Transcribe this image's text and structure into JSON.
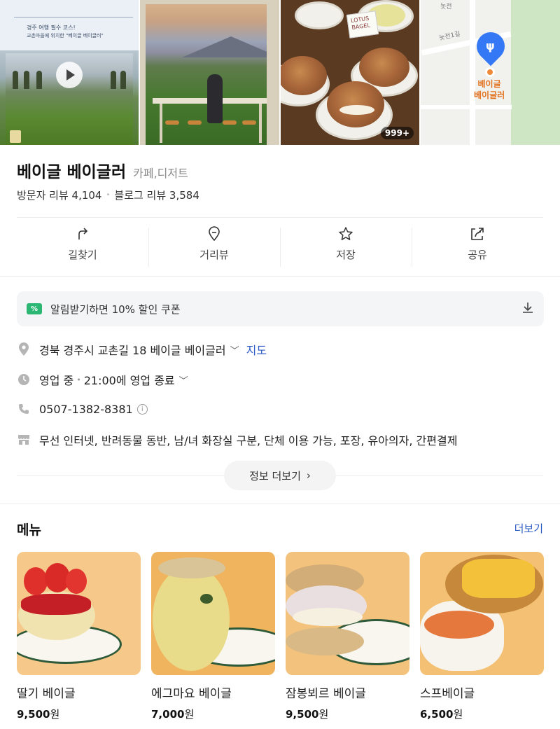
{
  "photos": {
    "poster_line1": "경주 여행 필수 코스!",
    "poster_line2": "교촌마을에 위치한 \"베이글 베이글러\"",
    "bakery_sign": "LOTUS BAGEL",
    "photo_count_badge": "999+",
    "map_road_label": "놋전1길",
    "map_road_label2": "놋전",
    "map_place_label_line1": "베이글",
    "map_place_label_line2": "베이글러"
  },
  "place": {
    "name": "베이글 베이글러",
    "category": "카페,디저트",
    "visitor_review_label": "방문자 리뷰 4,104",
    "blog_review_label": "블로그 리뷰 3,584"
  },
  "actions": [
    {
      "label": "길찾기",
      "icon": "directions-icon"
    },
    {
      "label": "거리뷰",
      "icon": "street-view-icon"
    },
    {
      "label": "저장",
      "icon": "star-icon"
    },
    {
      "label": "공유",
      "icon": "share-icon"
    }
  ],
  "coupon": {
    "icon_text": "%",
    "text": "알림받기하면 10% 할인 쿠폰"
  },
  "info": {
    "address": "경북 경주시 교촌길 18 베이글 베이글러",
    "map_link": "지도",
    "status": "영업 중",
    "hours": "21:00에 영업 종료",
    "phone": "0507-1382-8381",
    "phone_info_icon": "i",
    "amenities": "무선 인터넷, 반려동물 동반, 남/녀 화장실 구분, 단체 이용 가능, 포장, 유아의자, 간편결제",
    "more_info_label": "정보 더보기"
  },
  "menu": {
    "title": "메뉴",
    "more_label": "더보기",
    "items": [
      {
        "name": "딸기 베이글",
        "price": "9,500",
        "unit": "원"
      },
      {
        "name": "에그마요 베이글",
        "price": "7,000",
        "unit": "원"
      },
      {
        "name": "잠봉뵈르 베이글",
        "price": "9,500",
        "unit": "원"
      },
      {
        "name": "스프베이글",
        "price": "6,500",
        "unit": "원"
      }
    ]
  },
  "colors": {
    "link_blue": "#2e5cc7",
    "coupon_green": "#2bb673",
    "map_pin_blue": "#3478f6",
    "map_label_orange": "#e2711d"
  }
}
